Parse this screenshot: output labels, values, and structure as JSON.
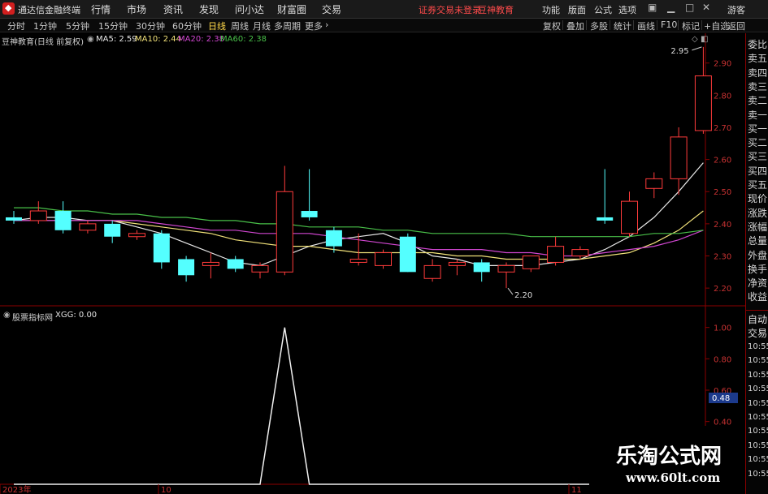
{
  "app": {
    "title": "通达信金融终端"
  },
  "menu": [
    "行情",
    "市场",
    "资讯",
    "发现",
    "问小达",
    "财富圈",
    "交易"
  ],
  "notice": {
    "login": "证券交易未登录",
    "brand": "豆神教育"
  },
  "window_buttons": [
    "功能",
    "版面",
    "公式",
    "选项"
  ],
  "guest": "游客",
  "periods": [
    "分时",
    "1分钟",
    "5分钟",
    "15分钟",
    "30分钟",
    "60分钟",
    "日线",
    "周线",
    "月线",
    "多周期",
    "更多"
  ],
  "active_period": "日线",
  "toolbar_right": [
    "复权",
    "叠加",
    "多股",
    "统计",
    "画线",
    "F10",
    "标记",
    "+自选",
    "返回"
  ],
  "main_legend": {
    "title": "豆神教育(日线 前复权)",
    "ma": [
      {
        "label": "MA5: 2.59",
        "color": "#e8e8e8"
      },
      {
        "label": "MA10: 2.44",
        "color": "#f2e27a"
      },
      {
        "label": "MA20: 2.38",
        "color": "#d046d0"
      },
      {
        "label": "MA60: 2.38",
        "color": "#49c049"
      }
    ]
  },
  "indicator_legend": {
    "title": "股票指标网",
    "value": "XGG: 0.00"
  },
  "sidebar": {
    "items": [
      "委比",
      "卖五",
      "卖四",
      "卖三",
      "卖二",
      "卖一",
      "买一",
      "买二",
      "买三",
      "买四",
      "买五",
      "现价",
      "涨跌",
      "涨幅",
      "总量",
      "外盘",
      "换手",
      "净资",
      "收益"
    ],
    "auto": "自动",
    "trade": "交易",
    "times": [
      "10:55",
      "10:55",
      "10:55",
      "10:55",
      "10:55",
      "10:55",
      "10:55",
      "10:55",
      "10:55",
      "10:55"
    ]
  },
  "watermark": {
    "name": "乐淘公式网",
    "url": "www.60lt.com"
  },
  "chart_data": [
    {
      "type": "candlestick",
      "ylim": [
        2.16,
        2.98
      ],
      "yticks": [
        2.2,
        2.3,
        2.4,
        2.5,
        2.6,
        2.7,
        2.8,
        2.9
      ],
      "annotations": [
        {
          "label": "2.95",
          "value": 2.95
        },
        {
          "label": "2.20",
          "value": 2.2
        }
      ],
      "x_labels": [
        "2023年",
        "10",
        "11"
      ],
      "candles": [
        {
          "o": 2.42,
          "h": 2.44,
          "l": 2.4,
          "c": 2.41
        },
        {
          "o": 2.41,
          "h": 2.47,
          "l": 2.4,
          "c": 2.44
        },
        {
          "o": 2.44,
          "h": 2.47,
          "l": 2.37,
          "c": 2.38
        },
        {
          "o": 2.38,
          "h": 2.41,
          "l": 2.37,
          "c": 2.4
        },
        {
          "o": 2.4,
          "h": 2.41,
          "l": 2.34,
          "c": 2.36
        },
        {
          "o": 2.36,
          "h": 2.38,
          "l": 2.35,
          "c": 2.37
        },
        {
          "o": 2.37,
          "h": 2.38,
          "l": 2.26,
          "c": 2.28
        },
        {
          "o": 2.29,
          "h": 2.3,
          "l": 2.22,
          "c": 2.24
        },
        {
          "o": 2.27,
          "h": 2.31,
          "l": 2.23,
          "c": 2.28
        },
        {
          "o": 2.29,
          "h": 2.3,
          "l": 2.25,
          "c": 2.26
        },
        {
          "o": 2.25,
          "h": 2.28,
          "l": 2.23,
          "c": 2.27
        },
        {
          "o": 2.25,
          "h": 2.58,
          "l": 2.24,
          "c": 2.5
        },
        {
          "o": 2.44,
          "h": 2.57,
          "l": 2.41,
          "c": 2.42
        },
        {
          "o": 2.38,
          "h": 2.39,
          "l": 2.31,
          "c": 2.33
        },
        {
          "o": 2.28,
          "h": 2.37,
          "l": 2.27,
          "c": 2.29
        },
        {
          "o": 2.27,
          "h": 2.32,
          "l": 2.26,
          "c": 2.31
        },
        {
          "o": 2.36,
          "h": 2.37,
          "l": 2.25,
          "c": 2.25
        },
        {
          "o": 2.23,
          "h": 2.29,
          "l": 2.22,
          "c": 2.27
        },
        {
          "o": 2.27,
          "h": 2.29,
          "l": 2.24,
          "c": 2.28
        },
        {
          "o": 2.28,
          "h": 2.29,
          "l": 2.22,
          "c": 2.25
        },
        {
          "o": 2.25,
          "h": 2.28,
          "l": 2.2,
          "c": 2.27
        },
        {
          "o": 2.26,
          "h": 2.3,
          "l": 2.25,
          "c": 2.3
        },
        {
          "o": 2.28,
          "h": 2.36,
          "l": 2.27,
          "c": 2.33
        },
        {
          "o": 2.3,
          "h": 2.33,
          "l": 2.29,
          "c": 2.32
        },
        {
          "o": 2.42,
          "h": 2.57,
          "l": 2.4,
          "c": 2.41
        },
        {
          "o": 2.37,
          "h": 2.5,
          "l": 2.36,
          "c": 2.47
        },
        {
          "o": 2.51,
          "h": 2.56,
          "l": 2.48,
          "c": 2.54
        },
        {
          "o": 2.54,
          "h": 2.7,
          "l": 2.49,
          "c": 2.67
        },
        {
          "o": 2.69,
          "h": 2.95,
          "l": 2.68,
          "c": 2.86
        }
      ],
      "ma": [
        {
          "name": "MA5",
          "color": "#e8e8e8",
          "values": [
            2.41,
            2.42,
            2.42,
            2.41,
            2.41,
            2.39,
            2.37,
            2.34,
            2.31,
            2.28,
            2.27,
            2.3,
            2.33,
            2.35,
            2.36,
            2.37,
            2.34,
            2.3,
            2.29,
            2.27,
            2.27,
            2.27,
            2.28,
            2.29,
            2.32,
            2.36,
            2.42,
            2.5,
            2.59
          ]
        },
        {
          "name": "MA10",
          "color": "#f2e27a",
          "values": [
            2.41,
            2.41,
            2.41,
            2.41,
            2.41,
            2.4,
            2.39,
            2.38,
            2.37,
            2.35,
            2.34,
            2.33,
            2.33,
            2.32,
            2.31,
            2.31,
            2.31,
            2.31,
            2.3,
            2.3,
            2.29,
            2.29,
            2.29,
            2.29,
            2.3,
            2.31,
            2.34,
            2.38,
            2.44
          ]
        },
        {
          "name": "MA20",
          "color": "#d046d0",
          "values": [
            2.41,
            2.41,
            2.41,
            2.41,
            2.41,
            2.41,
            2.4,
            2.39,
            2.38,
            2.38,
            2.37,
            2.37,
            2.37,
            2.36,
            2.35,
            2.34,
            2.33,
            2.32,
            2.32,
            2.32,
            2.31,
            2.31,
            2.3,
            2.3,
            2.31,
            2.32,
            2.33,
            2.35,
            2.38
          ]
        },
        {
          "name": "MA60",
          "color": "#49c049",
          "values": [
            2.45,
            2.45,
            2.44,
            2.44,
            2.43,
            2.43,
            2.42,
            2.42,
            2.41,
            2.41,
            2.4,
            2.4,
            2.39,
            2.39,
            2.39,
            2.38,
            2.38,
            2.37,
            2.37,
            2.37,
            2.37,
            2.36,
            2.36,
            2.36,
            2.36,
            2.36,
            2.37,
            2.37,
            2.38
          ]
        }
      ]
    },
    {
      "type": "line",
      "series": [
        {
          "name": "XGG",
          "values": [
            0,
            0,
            0,
            0,
            0,
            0,
            0,
            0,
            0,
            0,
            0,
            1,
            0,
            0,
            0,
            0,
            0,
            0,
            0,
            0,
            0,
            0,
            0,
            0,
            0,
            0,
            0,
            0,
            0
          ]
        }
      ],
      "ylim": [
        0,
        1.05
      ],
      "yticks": [
        1.0,
        0.8,
        0.6,
        0.4
      ],
      "current": "0.48"
    }
  ]
}
